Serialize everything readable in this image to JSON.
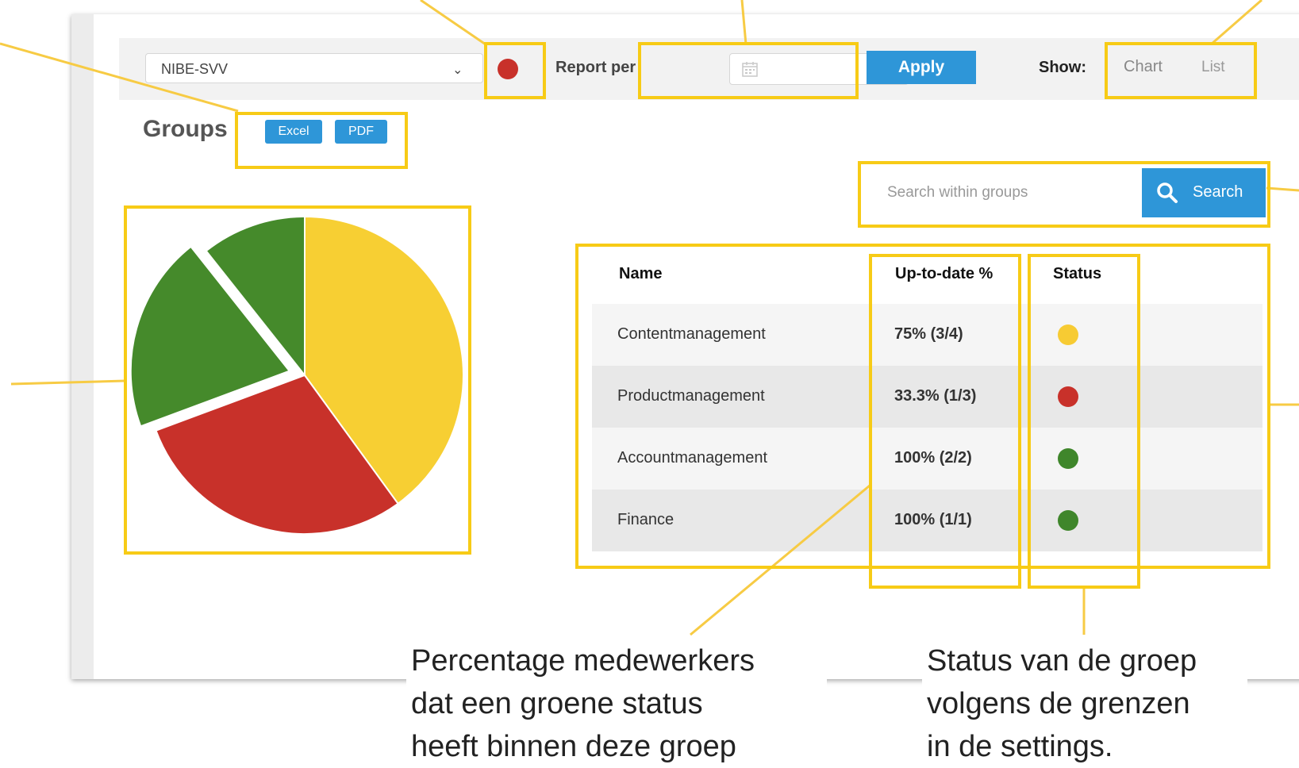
{
  "toolbar": {
    "department": "NIBE-SVV",
    "report_label": "Report per",
    "apply_label": "Apply",
    "show_label": "Show:",
    "toggle_chart": "Chart",
    "toggle_list": "List",
    "overall_status_color": "#c8312a"
  },
  "groups": {
    "title": "Groups",
    "excel_label": "Excel",
    "pdf_label": "PDF"
  },
  "search": {
    "placeholder": "Search within groups",
    "button_label": "Search"
  },
  "table": {
    "headers": [
      "Name",
      "Up-to-date %",
      "Status"
    ],
    "rows": [
      {
        "name": "Contentmanagement",
        "pct": "75% (3/4)",
        "status_color": "#f7cb33"
      },
      {
        "name": "Productmanagement",
        "pct": "33.3% (1/3)",
        "status_color": "#c8312a"
      },
      {
        "name": "Accountmanagement",
        "pct": "100% (2/2)",
        "status_color": "#3f862b"
      },
      {
        "name": "Finance",
        "pct": "100% (1/1)",
        "status_color": "#3f862b"
      }
    ]
  },
  "chart_data": {
    "type": "pie",
    "slices": [
      {
        "value": 3,
        "color": "#f7cf33"
      },
      {
        "value": 2.2,
        "color": "#c8312a"
      },
      {
        "value": 1.5,
        "color": "#458a2b",
        "exploded": true
      },
      {
        "value": 0.8,
        "color": "#458a2b"
      }
    ]
  },
  "callouts": {
    "percentage": [
      "Percentage medewerkers",
      "dat een groene status",
      "heeft binnen deze groep"
    ],
    "status": [
      "Status van de groep",
      "volgens de grenzen",
      "in de settings."
    ]
  },
  "colors": {
    "accent": "#2e96d8",
    "annotation": "#f7cb16"
  }
}
